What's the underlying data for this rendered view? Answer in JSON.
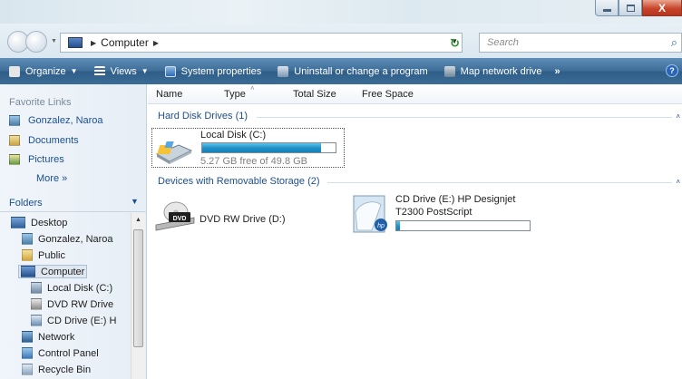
{
  "window": {
    "caption_buttons": {
      "minimize": "",
      "maximize": "",
      "close": "X"
    }
  },
  "address_bar": {
    "crumbs": [
      "Computer"
    ],
    "search_placeholder": "Search"
  },
  "toolbar": {
    "items": [
      {
        "label": "Organize",
        "has_arrow": true
      },
      {
        "label": "Views",
        "has_arrow": true
      },
      {
        "label": "System properties"
      },
      {
        "label": "Uninstall or change a program"
      },
      {
        "label": "Map network drive"
      }
    ],
    "more": "»"
  },
  "nav": {
    "favorites_title": "Favorite Links",
    "favorites": [
      "Gonzalez, Naroa",
      "Documents",
      "Pictures"
    ],
    "more_label": "More",
    "more_glyph": "»",
    "folders_title": "Folders",
    "tree": [
      {
        "label": "Desktop"
      },
      {
        "label": "Gonzalez, Naroa"
      },
      {
        "label": "Public"
      },
      {
        "label": "Computer"
      },
      {
        "label": "Local Disk (C:)"
      },
      {
        "label": "DVD RW Drive"
      },
      {
        "label": "CD Drive (E:) H"
      },
      {
        "label": "Network"
      },
      {
        "label": "Control Panel"
      },
      {
        "label": "Recycle Bin"
      }
    ]
  },
  "columns": [
    "Name",
    "Type",
    "Total Size",
    "Free Space"
  ],
  "groups": {
    "hard_disks": {
      "title": "Hard Disk Drives (1)",
      "drive": {
        "name": "Local Disk (C:)",
        "free_text": "5.27 GB free of 49.8 GB",
        "used_fraction": 0.894
      }
    },
    "removable": {
      "title": "Devices with Removable Storage (2)",
      "dvd": {
        "name": "DVD RW Drive (D:)",
        "badge": "DVD"
      },
      "cd": {
        "name_line1": "CD Drive (E:) HP Designjet",
        "name_line2": "T2300 PostScript",
        "used_fraction": 0.03
      }
    }
  },
  "colors": {
    "toolbar": "#3f6f99",
    "link": "#1c4f8e",
    "bar_fill": "#1e8fc6",
    "close_button": "#c8452b"
  }
}
